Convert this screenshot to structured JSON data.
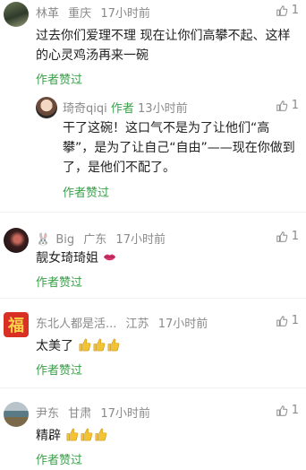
{
  "comments": [
    {
      "user": "林革",
      "location": "重庆",
      "time": "17小时前",
      "likes": "1",
      "text": "过去你们爱理不理 现在让你们高攀不起、这样的心灵鸡汤再来一碗",
      "author_liked": "作者赞过",
      "reply": {
        "user": "琦奇qiqi",
        "badge": "作者",
        "time": "13小时前",
        "likes": "1",
        "text": "干了这碗！这口气不是为了让他们“高攀”，是为了让自己“自由”——现在你做到了，是他们不配了。",
        "author_liked": "作者赞过"
      }
    },
    {
      "user": "Big",
      "location": "广东",
      "time": "17小时前",
      "likes": "1",
      "text": "靓女琦琦姐",
      "author_liked": "作者赞过"
    },
    {
      "user": "东北人都是活...",
      "location": "江苏",
      "time": "17小时前",
      "likes": "1",
      "avatar_char": "福",
      "text": "太美了",
      "author_liked": "作者赞过"
    },
    {
      "user": "尹东",
      "location": "甘肃",
      "time": "17小时前",
      "likes": "1",
      "text": "精辟",
      "author_liked": "作者赞过"
    }
  ],
  "colors": {
    "accent_green": "#3aa04a",
    "meta_gray": "#8a8a8a"
  }
}
